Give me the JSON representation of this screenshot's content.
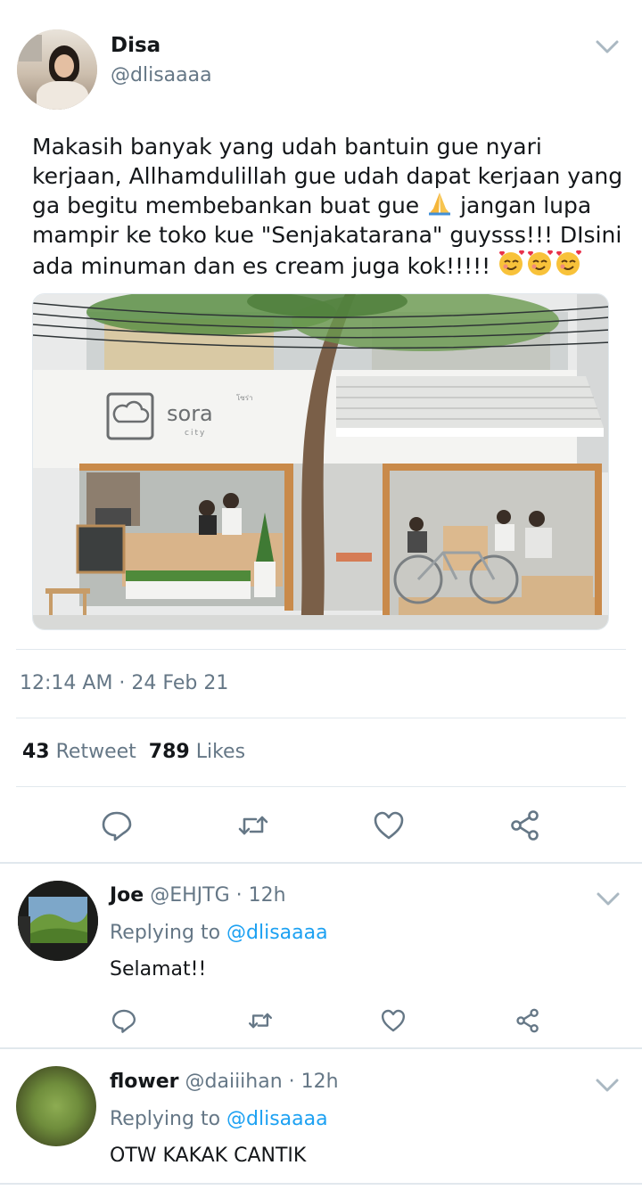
{
  "tweet": {
    "author_name": "Disa",
    "author_handle": "@dlisaaaa",
    "text_lines": [
      "Makasih banyak yang udah bantuin gue nyari",
      "kerjaan, Allhamdulillah gue udah dapat kerjaan yang",
      "ga begitu membebankan buat gue",
      "jangan lupa",
      "mampir ke toko kue \"Senjakatarana\" guysss!!! DIsini",
      "ada minuman dan es cream juga kok!!!!!"
    ],
    "photo": {
      "sign_title": "sora",
      "sign_subtitle": "city",
      "sign_small": "โซร่า"
    },
    "timestamp": "12:14 AM · 24 Feb 21",
    "retweet_count": "43",
    "retweet_label": "Retweet",
    "like_count": "789",
    "like_label": "Likes"
  },
  "replies": [
    {
      "name": "Joe",
      "handle": "@EHJTG",
      "time": "· 12h",
      "replying_label": "Replying to",
      "replying_to": "@dlisaaaa",
      "text": "Selamat!!"
    },
    {
      "name": "flower",
      "handle": "@daiiihan",
      "time": "· 12h",
      "replying_label": "Replying to",
      "replying_to": "@dlisaaaa",
      "text": "OTW KAKAK CANTIK"
    }
  ],
  "icons": {
    "reply": "reply-icon",
    "retweet": "retweet-icon",
    "like": "heart-icon",
    "share": "share-icon",
    "more": "chevron-down-icon"
  },
  "colors": {
    "link": "#1da1f2",
    "secondary_text": "#657786",
    "separator": "#e1e8ed"
  }
}
